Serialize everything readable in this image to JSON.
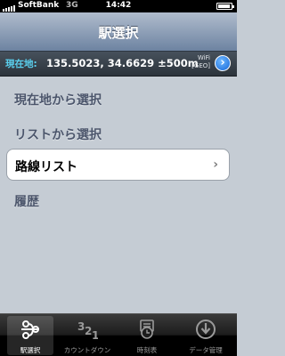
{
  "status_bar": {
    "carrier": "SoftBank",
    "network": "3G",
    "time": "14:42"
  },
  "nav_bar": {
    "title": "駅選択"
  },
  "location_bar": {
    "label": "現在地:",
    "coords": "135.5023, 34.6629 ±500m",
    "source_line1": "WiFi",
    "source_line2": "[GEO]"
  },
  "menu": {
    "items": [
      {
        "label": "現在地から選択"
      },
      {
        "label": "リストから選択"
      },
      {
        "label": "路線リスト"
      },
      {
        "label": "履歴"
      }
    ]
  },
  "tab_bar": {
    "tabs": [
      {
        "label": "駅選択",
        "icon": "station-select-icon"
      },
      {
        "label": "カウントダウン",
        "icon": "countdown-icon"
      },
      {
        "label": "時刻表",
        "icon": "timetable-icon"
      },
      {
        "label": "データ管理",
        "icon": "download-icon"
      }
    ]
  }
}
